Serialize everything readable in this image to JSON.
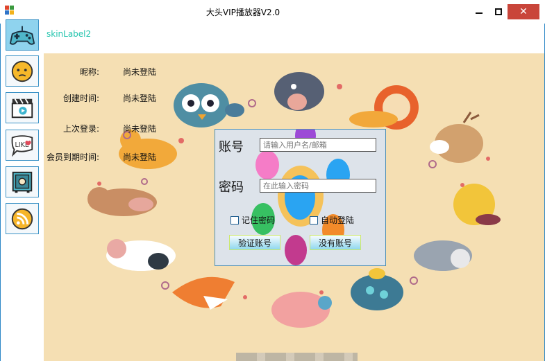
{
  "window": {
    "title": "大头VIP播放器V2.0",
    "close_glyph": "✕"
  },
  "skin_label": "skinLabel2",
  "sidebar": {
    "items": [
      {
        "icon": "gamepad-icon"
      },
      {
        "icon": "emoji-face-icon"
      },
      {
        "icon": "video-clapper-icon"
      },
      {
        "icon": "like-bubble-icon"
      },
      {
        "icon": "safe-box-icon"
      },
      {
        "icon": "rss-feed-icon"
      }
    ]
  },
  "user_info": {
    "nickname_label": "昵称:",
    "nickname_value": "尚未登陆",
    "created_label": "创建时间:",
    "created_value": "尚未登陆",
    "last_login_label": "上次登录:",
    "last_login_value": "尚未登陆",
    "vip_expire_label": "会员到期时间:",
    "vip_expire_value": "尚未登陆"
  },
  "login": {
    "account_label": "账号",
    "account_placeholder": "请输入用户名/邮箱",
    "password_label": "密码",
    "password_placeholder": "在此输入密码",
    "remember_label": "记住密码",
    "autologin_label": "自动登陆",
    "verify_button": "验证账号",
    "register_button": "没有账号"
  },
  "colors": {
    "accent": "#2b87c6",
    "skin_label": "#21c4ad",
    "background": "#f5dfb3",
    "close_button": "#c9453a"
  }
}
